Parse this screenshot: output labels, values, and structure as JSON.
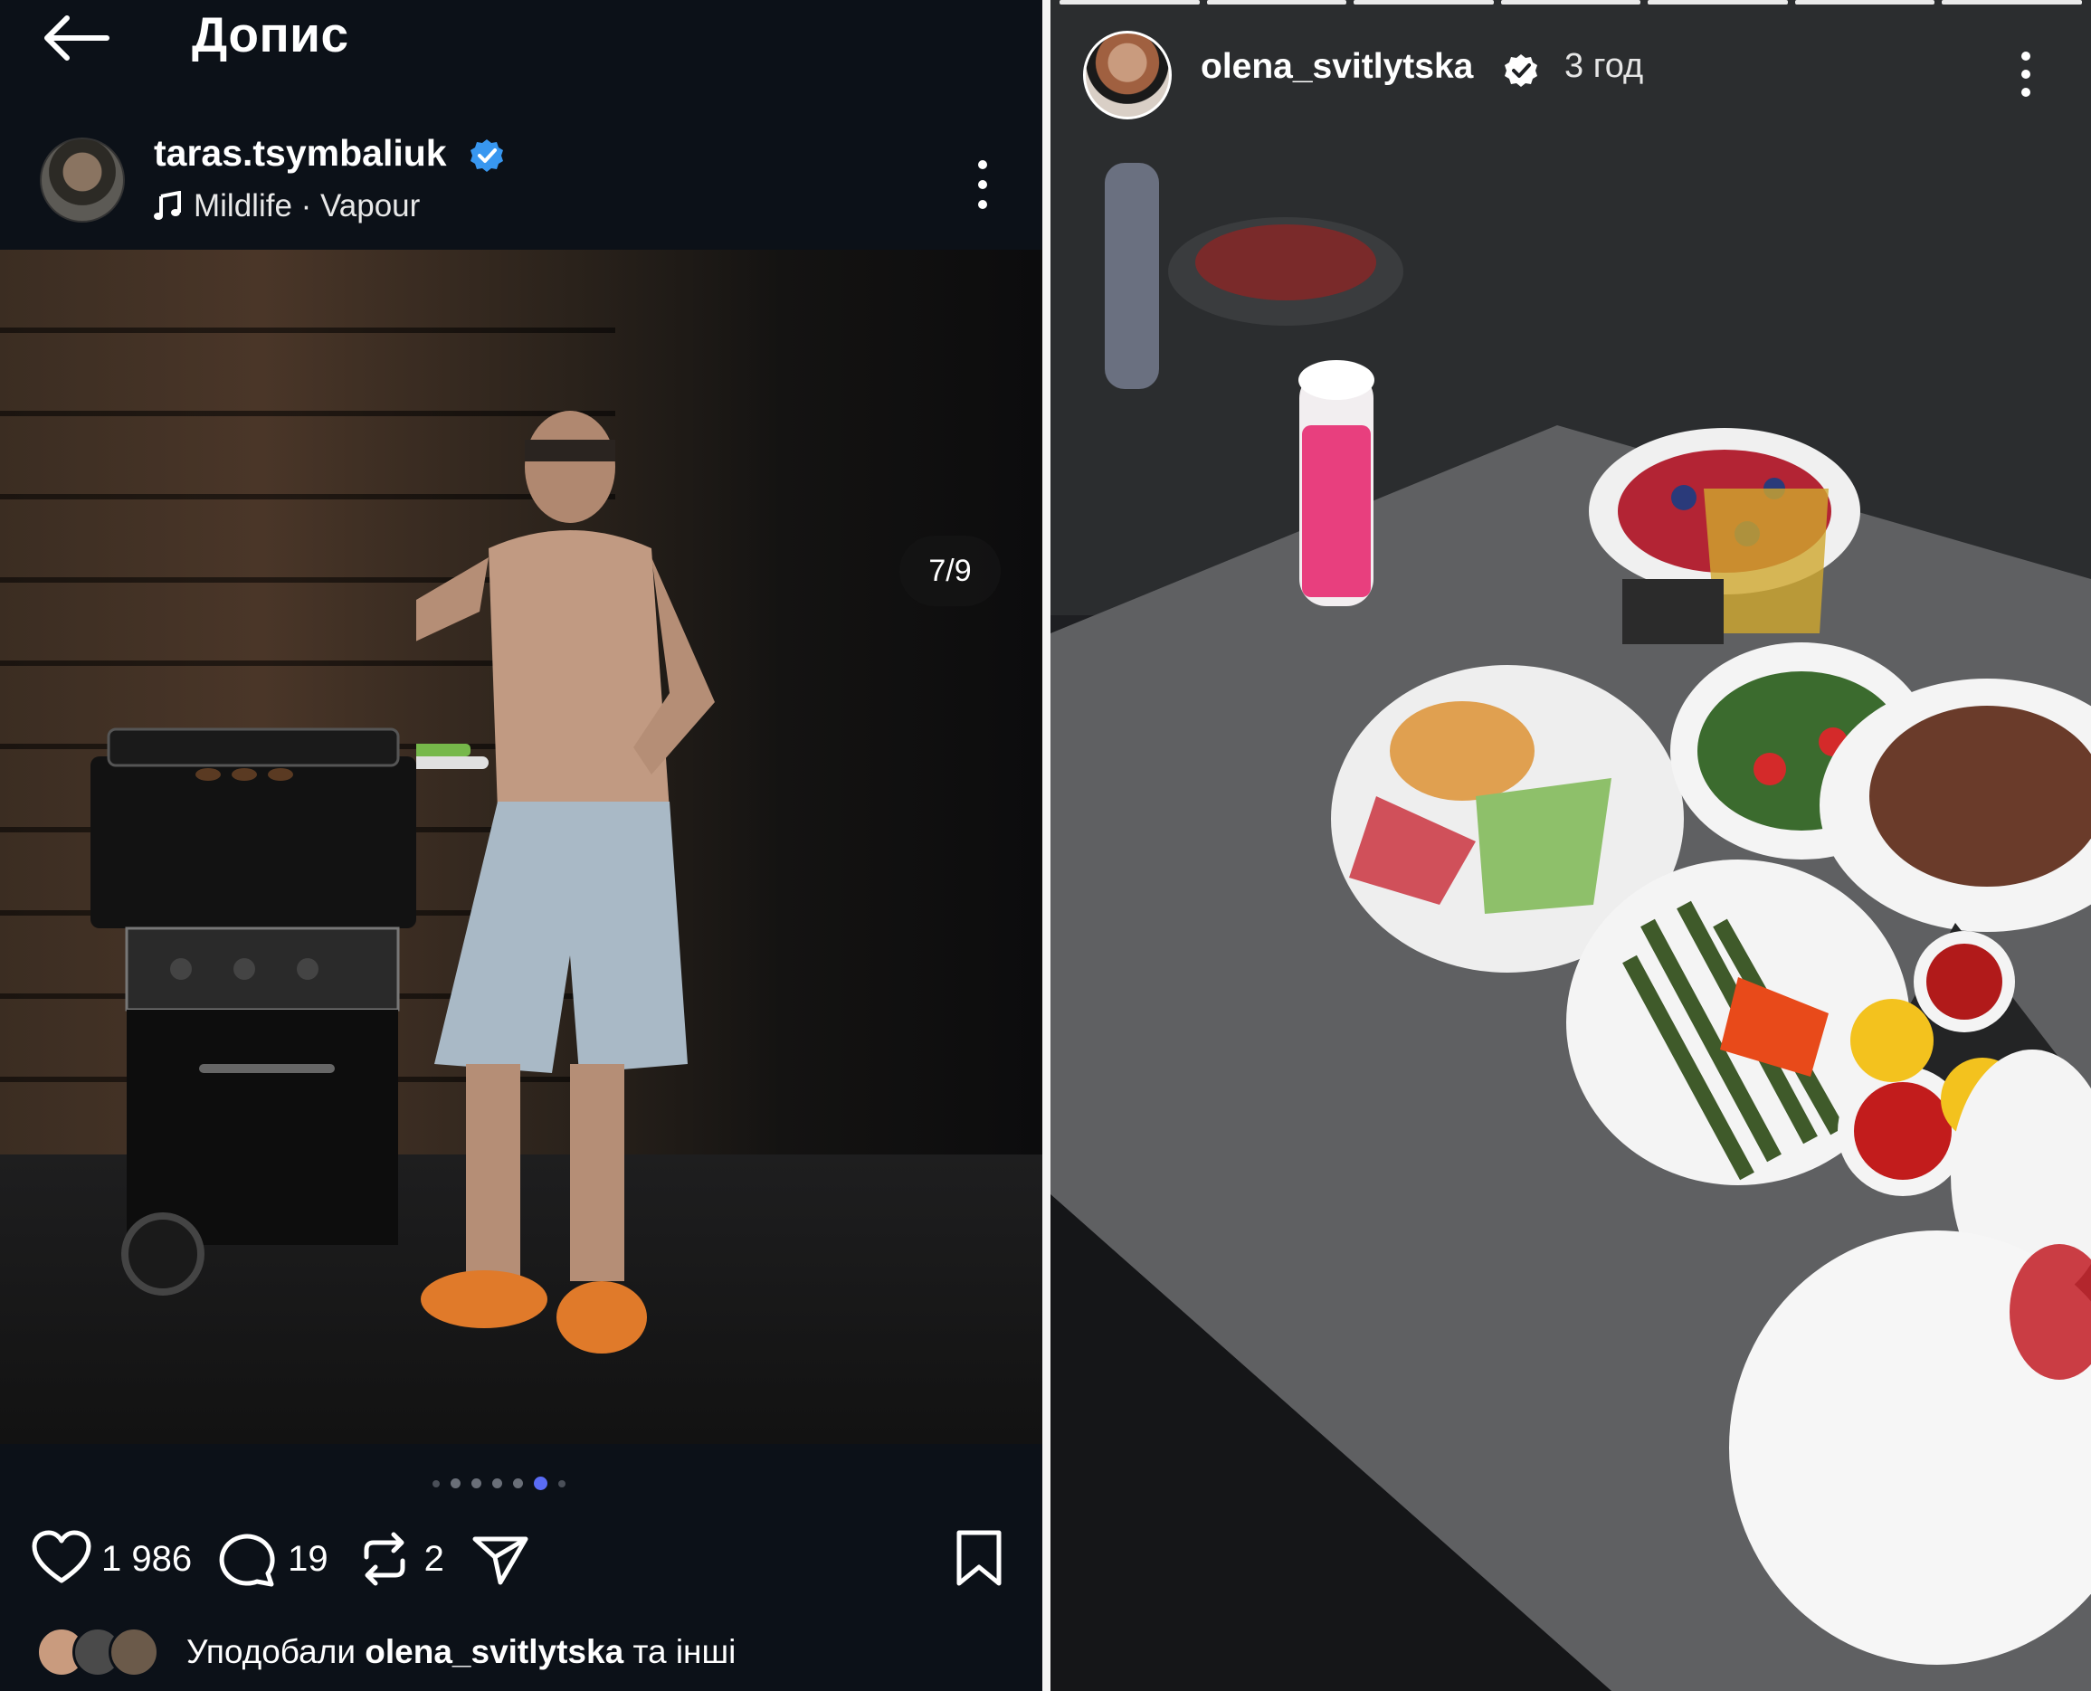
{
  "post_view": {
    "page_title": "Допис",
    "author": {
      "username": "taras.tsymbaliuk",
      "verified": true,
      "music": "Mildlife · Vapour"
    },
    "media": {
      "counter": "7/9",
      "current_index": 7,
      "total": 9
    },
    "stats": {
      "likes": "1 986",
      "comments": "19",
      "reposts": "2"
    },
    "liked_by": {
      "prefix": "Уподобали",
      "user": "olena_svitlytska",
      "suffix": "та інші"
    }
  },
  "story_view": {
    "username": "olena_svitlytska",
    "verified": true,
    "time": "3 год",
    "segments": 7
  },
  "colors": {
    "accent_blue": "#3897f0",
    "active_dot": "#5a6cf5",
    "left_background": "#0c1118"
  },
  "icons": [
    "back-arrow-icon",
    "verified-icon",
    "music-note-icon",
    "more-icon",
    "sound-icon",
    "heart-icon",
    "comment-icon",
    "repost-icon",
    "share-icon",
    "bookmark-icon"
  ]
}
